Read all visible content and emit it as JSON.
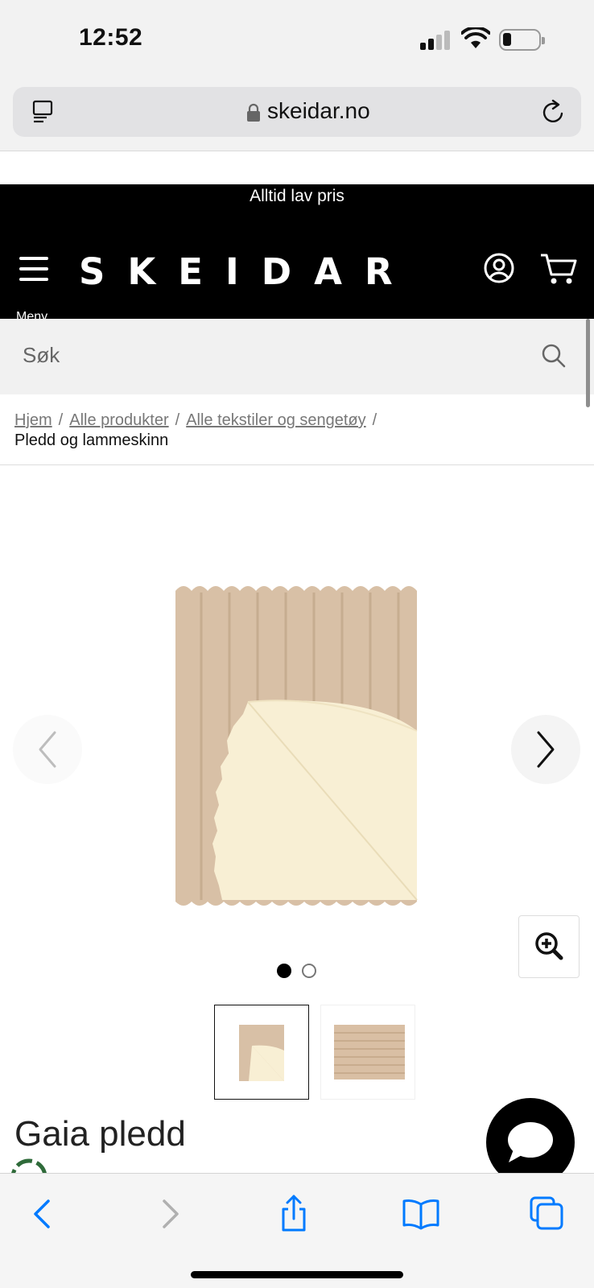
{
  "status_bar": {
    "time": "12:52",
    "signal_bars": 2,
    "battery_level": 0.15
  },
  "browser": {
    "url": "skeidar.no",
    "icons": [
      "reader-icon",
      "lock-icon",
      "reload-icon"
    ]
  },
  "site": {
    "promo_banner": "Alltid lav pris",
    "logo": "SKEIDAR",
    "menu_label": "Meny",
    "header_icons": [
      "user-icon",
      "cart-icon"
    ],
    "search_placeholder": "Søk"
  },
  "breadcrumb": {
    "items": [
      "Hjem",
      "Alle produkter",
      "Alle tekstiler og sengetøy"
    ],
    "separator": "/",
    "current": "Pledd og lammeskinn"
  },
  "product": {
    "title": "Gaia pledd",
    "gallery": {
      "image_count": 2,
      "active_index": 0
    }
  },
  "toolbar_icons": [
    "back-icon",
    "forward-icon",
    "share-icon",
    "bookmarks-icon",
    "tabs-icon"
  ],
  "colors": {
    "header_bg": "#000000",
    "accent_blue": "#007aff",
    "blanket_tan": "#d8c0a6",
    "blanket_cream": "#f8efd4"
  }
}
